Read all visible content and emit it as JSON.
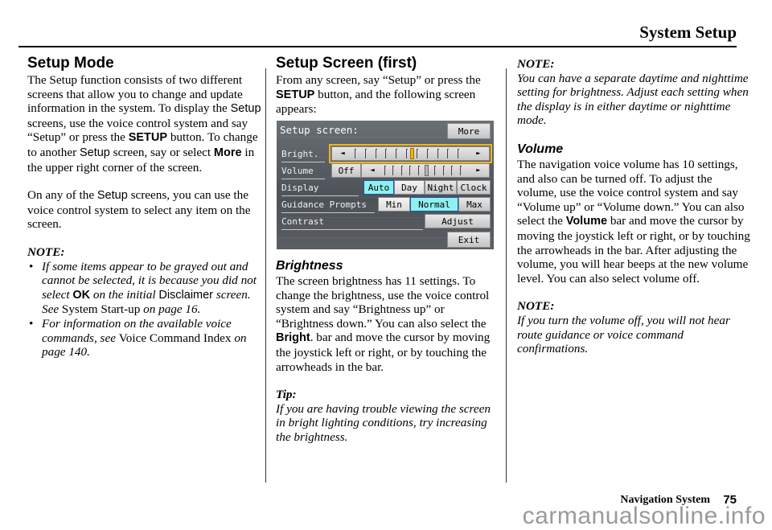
{
  "header": {
    "title": "System Setup"
  },
  "col1": {
    "heading": "Setup Mode",
    "p1": [
      {
        "t": "The Setup function consists of two different screens that allow you to change and update information in the system. To display the ",
        "s": "n"
      },
      {
        "t": "Setup",
        "s": "sans"
      },
      {
        "t": " screens, use the voice control system and say “Setup” or press the ",
        "s": "n"
      },
      {
        "t": "SETUP",
        "s": "sansb"
      },
      {
        "t": " button. To change to another ",
        "s": "n"
      },
      {
        "t": "Setup",
        "s": "sans"
      },
      {
        "t": " screen, say or select ",
        "s": "n"
      },
      {
        "t": "More",
        "s": "sansb"
      },
      {
        "t": " in the upper right corner of the screen.",
        "s": "n"
      }
    ],
    "p2": [
      {
        "t": "On any of the ",
        "s": "n"
      },
      {
        "t": "Setup",
        "s": "sans"
      },
      {
        "t": " screens, you can use the voice control system to select any item on the screen.",
        "s": "n"
      }
    ],
    "note_label": "NOTE:",
    "notes": [
      [
        {
          "t": "If some items appear to be grayed out and cannot be selected, it is because you did not select ",
          "s": "it"
        },
        {
          "t": "OK",
          "s": "sansb"
        },
        {
          "t": " on the initial ",
          "s": "it"
        },
        {
          "t": "Disclaimer",
          "s": "sans"
        },
        {
          "t": " screen. See ",
          "s": "it"
        },
        {
          "t": "System Start-up",
          "s": "n"
        },
        {
          "t": " on page 16.",
          "s": "it"
        }
      ],
      [
        {
          "t": "For information on the available voice commands, see ",
          "s": "it"
        },
        {
          "t": "Voice Command Index",
          "s": "n"
        },
        {
          "t": " on page 140.",
          "s": "it"
        }
      ]
    ],
    "bullet": "•"
  },
  "col2": {
    "heading": "Setup Screen (first)",
    "intro": [
      {
        "t": "From any screen, say “Setup” or press the ",
        "s": "n"
      },
      {
        "t": "SETUP",
        "s": "sansb"
      },
      {
        "t": " button, and the following screen appears:",
        "s": "n"
      }
    ],
    "subheading": "Brightness",
    "brightness_p": [
      {
        "t": "The screen brightness has 11 settings. To change the brightness, use the voice control system and say “Brightness up” or “Brightness down.” You can also select the ",
        "s": "n"
      },
      {
        "t": "Bright",
        "s": "sansb"
      },
      {
        "t": ". bar and move the cursor by moving the joystick left or right, or by touching the arrowheads in the bar.",
        "s": "n"
      }
    ],
    "tip_label": "Tip:",
    "tip_text": "If you are having trouble viewing the screen in bright lighting conditions, try increasing the brightness."
  },
  "screen": {
    "title": "Setup screen:",
    "more": "More",
    "rows": {
      "bright": "Bright.",
      "volume": "Volume",
      "display": "Display",
      "guidance": "Guidance Prompts",
      "contrast": "Contrast"
    },
    "bright_level": 0.5,
    "volume_level": 0.5,
    "volume_off": "Off",
    "display_options": [
      "Auto",
      "Day",
      "Night",
      "Clock"
    ],
    "display_selected": "Auto",
    "guidance_options": [
      "Min",
      "Normal",
      "Max"
    ],
    "guidance_selected": "Normal",
    "adjust": "Adjust",
    "exit": "Exit",
    "arrow_left": "◄",
    "arrow_right": "►"
  },
  "col3": {
    "note1_label": "NOTE:",
    "note1_text": "You can have a separate daytime and nighttime setting for brightness. Adjust each setting when the display is in either daytime or nighttime mode.",
    "volume_heading": "Volume",
    "volume_p": [
      {
        "t": "The navigation voice volume has 10 settings, and also can be turned off. To adjust the volume, use the voice control system and say “Volume up” or “Volume down.” You can also select the ",
        "s": "n"
      },
      {
        "t": "Volume",
        "s": "sansb"
      },
      {
        "t": " bar and move the cursor by moving the joystick left or right, or by touching the arrowheads in the bar. After adjusting the volume, you will hear beeps at the new volume level. You can also select volume off.",
        "s": "n"
      }
    ],
    "note2_label": "NOTE:",
    "note2_text": "If you turn the volume off, you will not hear route guidance or voice command confirmations."
  },
  "footer": {
    "section": "Navigation System",
    "page_number": "75",
    "watermark": "carmanualsonline.info"
  }
}
